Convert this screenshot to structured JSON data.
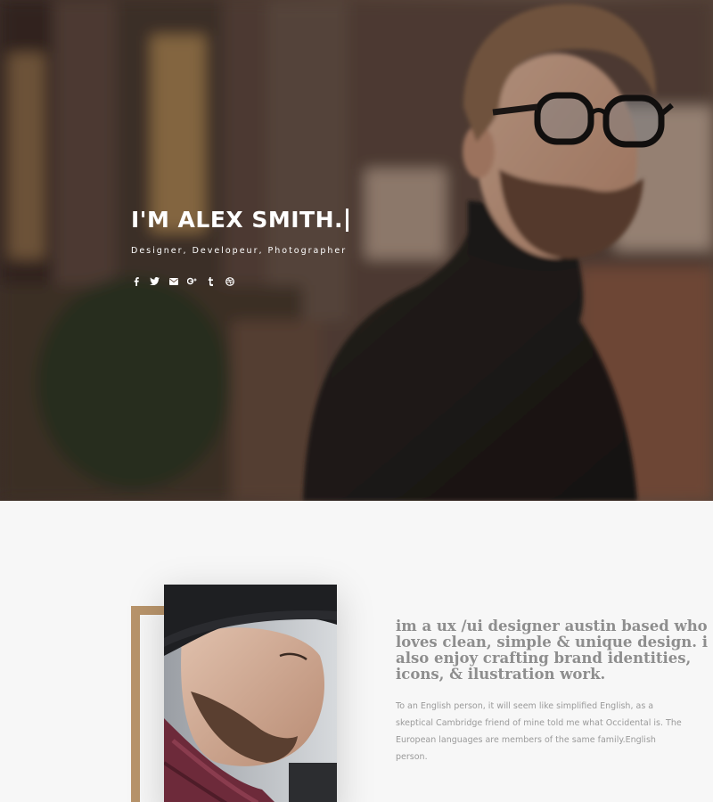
{
  "hero": {
    "title": "I'M ALEX SMITH.",
    "subtitle": "Designer, Developeur, Photographer",
    "socials": [
      {
        "icon": "facebook-icon",
        "glyph": "f"
      },
      {
        "icon": "twitter-icon",
        "glyph": "t"
      },
      {
        "icon": "mail-icon",
        "glyph": "m"
      },
      {
        "icon": "google-plus-icon",
        "glyph": "g+"
      },
      {
        "icon": "tumblr-icon",
        "glyph": "t"
      },
      {
        "icon": "dribbble-icon",
        "glyph": "o"
      }
    ]
  },
  "about": {
    "heading": "im a ux /ui designer austin based who loves clean, simple & unique design. i also enjoy crafting brand identities, icons, & ilustration work.",
    "body": "To an English person, it will seem like simplified English, as a skeptical Cambridge friend of mine told me what Occidental is. The European languages are members of the same family.English person."
  },
  "colors": {
    "accent": "#b8946b",
    "background": "#f7f7f7",
    "text_muted": "#9a9a9a"
  }
}
